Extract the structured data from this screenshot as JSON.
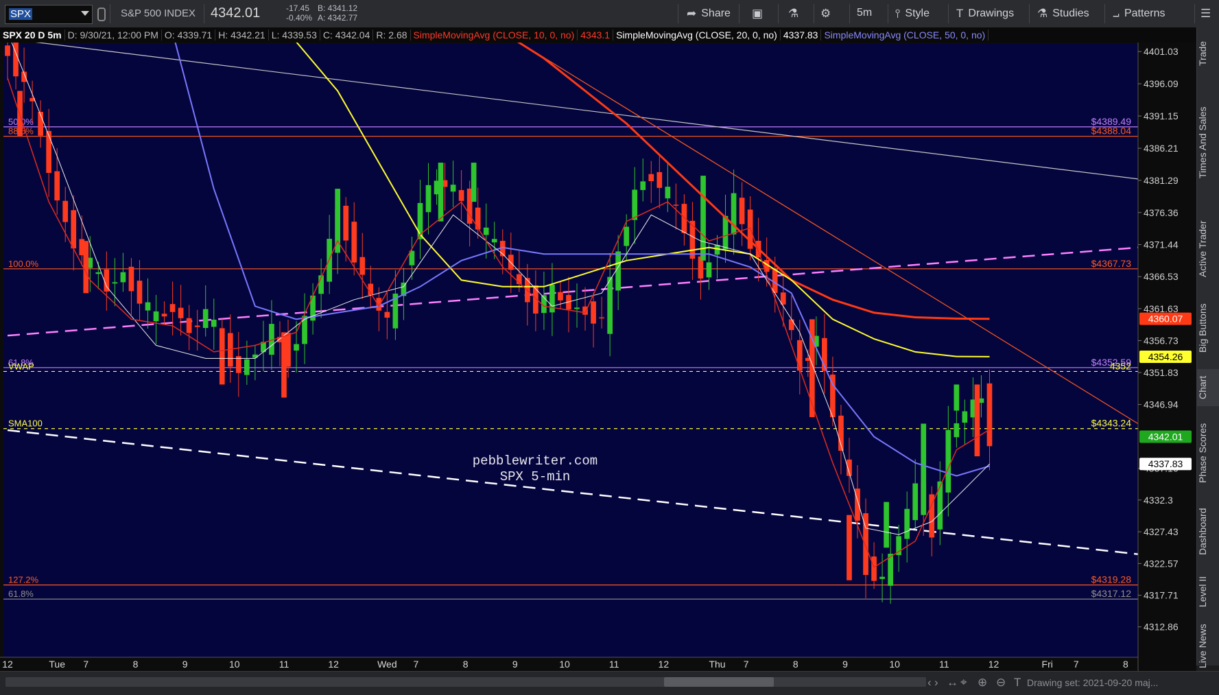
{
  "toolbar": {
    "symbol": "SPX",
    "index_name": "S&P 500 INDEX",
    "last_price": "4342.01",
    "net_change": "-17.45",
    "pct_change": "-0.40%",
    "bid": "B: 4341.12",
    "ask": "A: 4342.77",
    "share_label": "Share",
    "interval_label": "5m",
    "style_label": "Style",
    "drawings_label": "Drawings",
    "studies_label": "Studies",
    "patterns_label": "Patterns"
  },
  "header": {
    "title": "SPX 20 D 5m",
    "date": "D: 9/30/21, 12:00 PM",
    "open": "O: 4339.71",
    "high": "H: 4342.21",
    "low": "L: 4339.53",
    "close": "C: 4342.04",
    "range": "R: 2.68",
    "sma10": "SimpleMovingAvg (CLOSE, 10, 0, no)",
    "sma10_val": "4343.1",
    "sma20": "SimpleMovingAvg (CLOSE, 20, 0, no)",
    "sma20_val": "4337.83",
    "sma50": "SimpleMovingAvg (CLOSE, 50, 0, no)"
  },
  "sidebar": {
    "tabs": [
      "Trade",
      "Times And Sales",
      "Active Trader",
      "Big Buttons",
      "Chart",
      "Phase Scores",
      "Dashboard",
      "Level II",
      "Live News"
    ]
  },
  "bottom": {
    "drawing_set": "Drawing set: 2021-09-20 maj..."
  },
  "colors": {
    "background": "#05053d",
    "up_candle": "#2ec52e",
    "down_candle": "#ff3b1f",
    "sma10": "#e02b20",
    "sma20": "#f0f0f0",
    "sma50": "#7878ff",
    "sma100": "#ffff30",
    "sma200": "#ff3a14"
  },
  "chart_data": {
    "type": "candlestick",
    "watermark": [
      "pebblewriter.com",
      "SPX 5-min"
    ],
    "y_ticks": [
      4401.03,
      4396.09,
      4391.15,
      4386.21,
      4381.29,
      4376.36,
      4371.44,
      4366.53,
      4361.63,
      4356.73,
      4351.83,
      4346.94,
      4337.16,
      4332.3,
      4327.43,
      4322.57,
      4317.71,
      4312.86
    ],
    "y_tick_labels": [
      "4401.03",
      "4396.09",
      "4391.15",
      "4386.21",
      "4381.29",
      "4376.36",
      "4371.44",
      "4366.53",
      "4361.63",
      "4356.73",
      "4351.83",
      "4346.94",
      "4337.16",
      "4332.3",
      "4327.43",
      "4322.57",
      "4317.71",
      "4312.86"
    ],
    "ylim": [
      4308.2,
      4402.2
    ],
    "x_labels": [
      {
        "label": "12",
        "pos": 0
      },
      {
        "label": "Tue",
        "pos": 6
      },
      {
        "label": "7",
        "pos": 9.5
      },
      {
        "label": "8",
        "pos": 15.5
      },
      {
        "label": "9",
        "pos": 21.5
      },
      {
        "label": "10",
        "pos": 27.5
      },
      {
        "label": "11",
        "pos": 33.5
      },
      {
        "label": "12",
        "pos": 39.5
      },
      {
        "label": "Wed",
        "pos": 46
      },
      {
        "label": "7",
        "pos": 49.5
      },
      {
        "label": "8",
        "pos": 55.5
      },
      {
        "label": "9",
        "pos": 61.5
      },
      {
        "label": "10",
        "pos": 67.5
      },
      {
        "label": "11",
        "pos": 73.5
      },
      {
        "label": "12",
        "pos": 79.5
      },
      {
        "label": "Thu",
        "pos": 86
      },
      {
        "label": "7",
        "pos": 89.5
      },
      {
        "label": "8",
        "pos": 95.5
      },
      {
        "label": "9",
        "pos": 101.5
      },
      {
        "label": "10",
        "pos": 107.5
      },
      {
        "label": "11",
        "pos": 113.5
      },
      {
        "label": "12",
        "pos": 119.5
      },
      {
        "label": "Fri",
        "pos": 126
      },
      {
        "label": "7",
        "pos": 129.5
      },
      {
        "label": "8",
        "pos": 135.5
      }
    ],
    "bar_count": 120,
    "x_range": [
      -0.5,
      137
    ],
    "close_path": [
      [
        0,
        4401
      ],
      [
        2,
        4396
      ],
      [
        4,
        4388
      ],
      [
        6,
        4378
      ],
      [
        8,
        4372
      ],
      [
        10,
        4368
      ],
      [
        12,
        4365
      ],
      [
        14,
        4367
      ],
      [
        16,
        4363
      ],
      [
        18,
        4360
      ],
      [
        20,
        4362
      ],
      [
        22,
        4358
      ],
      [
        24,
        4361
      ],
      [
        26,
        4356
      ],
      [
        28,
        4352
      ],
      [
        30,
        4355
      ],
      [
        32,
        4358
      ],
      [
        34,
        4354
      ],
      [
        36,
        4360
      ],
      [
        38,
        4367
      ],
      [
        40,
        4376
      ],
      [
        42,
        4370
      ],
      [
        44,
        4363
      ],
      [
        46,
        4360
      ],
      [
        48,
        4366
      ],
      [
        50,
        4378
      ],
      [
        52,
        4381
      ],
      [
        54,
        4380
      ],
      [
        56,
        4376
      ],
      [
        58,
        4373
      ],
      [
        60,
        4370
      ],
      [
        62,
        4365
      ],
      [
        64,
        4362
      ],
      [
        66,
        4364
      ],
      [
        68,
        4362
      ],
      [
        70,
        4361
      ],
      [
        72,
        4360
      ],
      [
        74,
        4370
      ],
      [
        76,
        4380
      ],
      [
        78,
        4382
      ],
      [
        80,
        4379
      ],
      [
        82,
        4374
      ],
      [
        84,
        4366
      ],
      [
        86,
        4372
      ],
      [
        88,
        4378
      ],
      [
        90,
        4372
      ],
      [
        92,
        4367
      ],
      [
        94,
        4362
      ],
      [
        96,
        4352
      ],
      [
        98,
        4358
      ],
      [
        100,
        4345
      ],
      [
        102,
        4335
      ],
      [
        104,
        4322
      ],
      [
        106,
        4320
      ],
      [
        108,
        4327
      ],
      [
        110,
        4334
      ],
      [
        112,
        4328
      ],
      [
        114,
        4342
      ],
      [
        116,
        4346
      ],
      [
        118,
        4348
      ],
      [
        119,
        4342
      ]
    ],
    "candle_bodies": [
      {
        "x": 1.5,
        "open": 4395,
        "close": 4388
      },
      {
        "x": 9.5,
        "open": 4372,
        "close": 4364
      },
      {
        "x": 26,
        "open": 4356,
        "close": 4350
      },
      {
        "x": 33.5,
        "open": 4358,
        "close": 4348
      },
      {
        "x": 40,
        "open": 4372,
        "close": 4380
      },
      {
        "x": 52.5,
        "open": 4375,
        "close": 4384
      },
      {
        "x": 56.5,
        "open": 4378,
        "close": 4384
      },
      {
        "x": 84.3,
        "open": 4369,
        "close": 4382
      },
      {
        "x": 97.5,
        "open": 4360,
        "close": 4345
      },
      {
        "x": 102,
        "open": 4330,
        "close": 4320
      },
      {
        "x": 106.5,
        "open": 4325,
        "close": 4332
      },
      {
        "x": 111,
        "open": 4330,
        "close": 4344
      },
      {
        "x": 115,
        "open": 4346,
        "close": 4350
      },
      {
        "x": 117.5,
        "open": 4350,
        "close": 4339
      }
    ],
    "sma10_path": [
      [
        0,
        4397
      ],
      [
        5,
        4378
      ],
      [
        10,
        4366
      ],
      [
        15,
        4360
      ],
      [
        20,
        4359
      ],
      [
        25,
        4355
      ],
      [
        30,
        4356
      ],
      [
        35,
        4358
      ],
      [
        40,
        4372
      ],
      [
        45,
        4362
      ],
      [
        50,
        4373
      ],
      [
        55,
        4378
      ],
      [
        60,
        4368
      ],
      [
        65,
        4362
      ],
      [
        70,
        4361
      ],
      [
        75,
        4375
      ],
      [
        80,
        4378
      ],
      [
        85,
        4372
      ],
      [
        90,
        4374
      ],
      [
        95,
        4356
      ],
      [
        100,
        4338
      ],
      [
        105,
        4322
      ],
      [
        110,
        4326
      ],
      [
        115,
        4340
      ],
      [
        119,
        4343.1
      ]
    ],
    "sma20_path": [
      [
        0,
        4404
      ],
      [
        6,
        4385
      ],
      [
        12,
        4365
      ],
      [
        18,
        4356
      ],
      [
        24,
        4354
      ],
      [
        30,
        4354
      ],
      [
        36,
        4360
      ],
      [
        42,
        4363
      ],
      [
        48,
        4365
      ],
      [
        54,
        4376
      ],
      [
        60,
        4370
      ],
      [
        66,
        4362
      ],
      [
        72,
        4364
      ],
      [
        78,
        4376
      ],
      [
        84,
        4372
      ],
      [
        90,
        4370
      ],
      [
        96,
        4358
      ],
      [
        100,
        4345
      ],
      [
        104,
        4328
      ],
      [
        108,
        4327
      ],
      [
        112,
        4329
      ],
      [
        116,
        4334
      ],
      [
        119,
        4337.83
      ]
    ],
    "sma50_path": [
      [
        20,
        4404
      ],
      [
        25,
        4380
      ],
      [
        30,
        4362
      ],
      [
        35,
        4360
      ],
      [
        40,
        4361
      ],
      [
        45,
        4362
      ],
      [
        50,
        4365
      ],
      [
        55,
        4369
      ],
      [
        60,
        4371
      ],
      [
        65,
        4370
      ],
      [
        70,
        4370
      ],
      [
        75,
        4370
      ],
      [
        80,
        4370
      ],
      [
        85,
        4370
      ],
      [
        90,
        4368
      ],
      [
        95,
        4364
      ],
      [
        100,
        4350
      ],
      [
        105,
        4342
      ],
      [
        110,
        4338
      ],
      [
        115,
        4336
      ],
      [
        119,
        4337.5
      ]
    ],
    "sma100_path": [
      [
        34,
        4404
      ],
      [
        40,
        4395
      ],
      [
        45,
        4384
      ],
      [
        50,
        4373
      ],
      [
        55,
        4366
      ],
      [
        60,
        4365
      ],
      [
        65,
        4365
      ],
      [
        70,
        4367
      ],
      [
        75,
        4369
      ],
      [
        80,
        4370
      ],
      [
        85,
        4371
      ],
      [
        90,
        4370
      ],
      [
        95,
        4366
      ],
      [
        100,
        4360
      ],
      [
        105,
        4357
      ],
      [
        110,
        4355
      ],
      [
        115,
        4354.3
      ],
      [
        119,
        4354.26
      ]
    ],
    "sma200_path": [
      [
        60,
        4404
      ],
      [
        65,
        4400
      ],
      [
        70,
        4395
      ],
      [
        75,
        4390
      ],
      [
        80,
        4384
      ],
      [
        85,
        4378
      ],
      [
        90,
        4372
      ],
      [
        95,
        4366
      ],
      [
        100,
        4363
      ],
      [
        105,
        4361
      ],
      [
        110,
        4360.3
      ],
      [
        115,
        4360.1
      ],
      [
        119,
        4360.07
      ]
    ],
    "horizontal_lines": [
      {
        "label": "50.0%",
        "price": 4389.49,
        "price_label": "$4389.49",
        "color": "#c080ff",
        "dash": false
      },
      {
        "label": "88.6%",
        "price": 4388.04,
        "price_label": "$4388.04",
        "color": "#ff5a1f",
        "dash": false
      },
      {
        "label": "100.0%",
        "price": 4367.73,
        "price_label": "$4367.73",
        "color": "#ff5a1f",
        "dash": false
      },
      {
        "label": "61.8%",
        "price": 4352.59,
        "price_label": "$4352.59",
        "color": "#c080ff",
        "dash": false
      },
      {
        "label": "VWAP",
        "price": 4352.0,
        "price_label": "4352",
        "color": "#ffff40",
        "dash": true
      },
      {
        "label": "SMA100",
        "price": 4343.24,
        "price_label": "$4343.24",
        "color": "#ffff40",
        "dash": true
      },
      {
        "label": "127.2%",
        "price": 4319.28,
        "price_label": "$4319.28",
        "color": "#ff5a1f",
        "dash": false
      },
      {
        "label": "61.8%",
        "price": 4317.12,
        "price_label": "$4317.12",
        "color": "#909090",
        "dash": false
      }
    ],
    "trend_lines": [
      {
        "name": "gray-trendline",
        "from": [
          0,
          4403
        ],
        "to": [
          137,
          4381.5
        ],
        "color": "#c8c8c8",
        "dash": false
      },
      {
        "name": "pink-trendline",
        "from": [
          0,
          4357.5
        ],
        "to": [
          137,
          4371
        ],
        "color": "#ff80ff",
        "dash": true
      },
      {
        "name": "white-trendline",
        "from": [
          0,
          4343
        ],
        "to": [
          137,
          4324
        ],
        "color": "#ffffff",
        "dash": true
      },
      {
        "name": "orange-trendline",
        "from": [
          60,
          4404
        ],
        "to": [
          137,
          4344
        ],
        "color": "#ff5a1f",
        "dash": false
      }
    ],
    "price_tags": [
      {
        "value": 4360.07,
        "label": "4360.07",
        "bg": "#ff3a14",
        "fg": "#ffffff"
      },
      {
        "value": 4354.26,
        "label": "4354.26",
        "bg": "#ffff30",
        "fg": "#000000"
      },
      {
        "value": 4342.01,
        "label": "4342.01",
        "bg": "#1fa81f",
        "fg": "#ffffff"
      },
      {
        "value": 4337.83,
        "label": "4337.83",
        "bg": "#ffffff",
        "fg": "#000000"
      }
    ]
  }
}
